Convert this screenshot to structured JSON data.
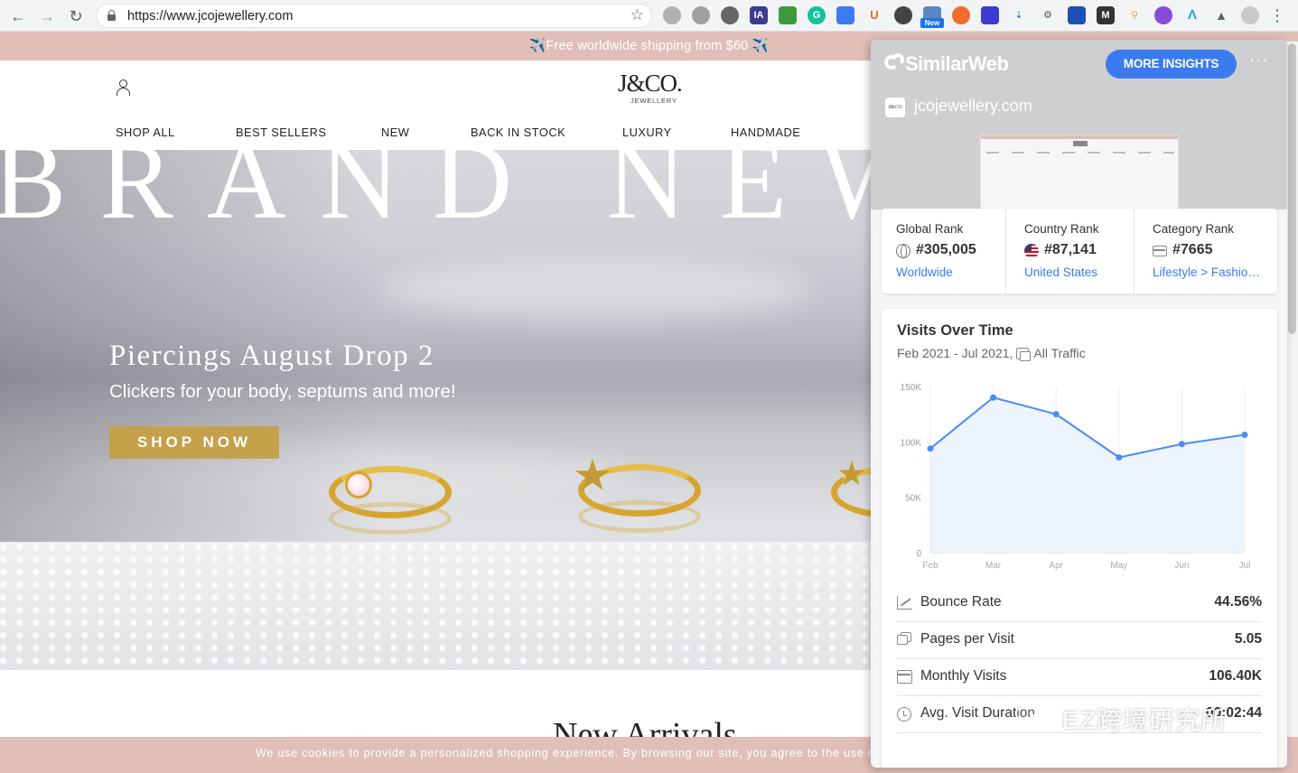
{
  "browser": {
    "url": "https://www.jcojewellery.com",
    "extension_badge": "New"
  },
  "site": {
    "announcement": "✈️Free worldwide shipping from $60 ✈️",
    "logo_main": "J&CO.",
    "logo_sub": "JEWELLERY",
    "nav": [
      "SHOP ALL",
      "BEST SELLERS",
      "NEW",
      "BACK IN STOCK",
      "LUXURY",
      "HANDMADE"
    ],
    "hero": {
      "headline": "BRAND NEW",
      "title": "Piercings August Drop 2",
      "subtitle": "Clickers for your body, septums and more!",
      "cta": "SHOP NOW"
    },
    "section_title": "New Arrivals",
    "cookie_text": "We use cookies to provide a personalized shopping experience. By browsing our site, you agree to the use of co"
  },
  "similarweb": {
    "brand": "SimilarWeb",
    "more_insights": "MORE INSIGHTS",
    "menu": "···",
    "domain": "jcojewellery.com",
    "favicon_text": "J&CO",
    "ranks": [
      {
        "label": "Global Rank",
        "value": "#305,005",
        "link": "Worldwide",
        "icon": "globe-icon"
      },
      {
        "label": "Country Rank",
        "value": "#87,141",
        "link": "United States",
        "icon": "us-flag-icon"
      },
      {
        "label": "Category Rank",
        "value": "#7665",
        "link": "Lifestyle > Fashion & Apparel",
        "icon": "category-icon"
      }
    ],
    "visits": {
      "title": "Visits Over Time",
      "period": "Feb 2021 - Jul 2021,",
      "traffic": "All Traffic"
    },
    "metrics": [
      {
        "label": "Bounce Rate",
        "value": "44.56%",
        "icon": "trend-icon"
      },
      {
        "label": "Pages per Visit",
        "value": "5.05",
        "icon": "pages-icon"
      },
      {
        "label": "Monthly Visits",
        "value": "106.40K",
        "icon": "calendar-icon"
      },
      {
        "label": "Avg. Visit Duration",
        "value": "00:02:44",
        "icon": "clock-icon"
      }
    ]
  },
  "watermark": "EZ跨境研究所",
  "colors": {
    "accent_blue": "#3a7bf0",
    "announcement_pink": "#e0bfb8",
    "gold": "#c4a14a",
    "chart_line": "#4a8ef0",
    "chart_fill": "#eef4fd"
  },
  "chart_data": {
    "type": "area",
    "title": "Visits Over Time",
    "categories": [
      "Feb",
      "Mar",
      "Apr",
      "May",
      "Jun",
      "Jul"
    ],
    "values": [
      94000,
      140000,
      125000,
      86000,
      98000,
      106400
    ],
    "y_ticks": [
      "150K",
      "100K",
      "50K",
      "0"
    ],
    "ylim": [
      0,
      150000
    ],
    "grid": "vertical"
  }
}
